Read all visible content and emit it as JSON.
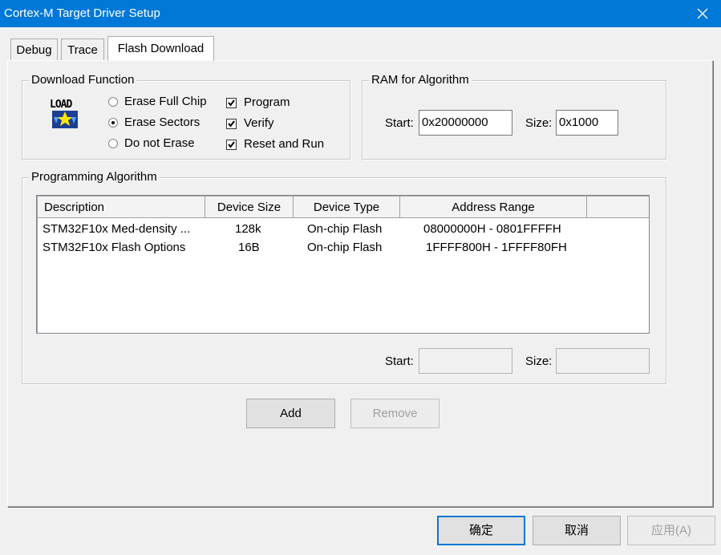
{
  "window": {
    "title": "Cortex-M Target Driver Setup"
  },
  "tabs": [
    {
      "label": "Debug",
      "active": false
    },
    {
      "label": "Trace",
      "active": false
    },
    {
      "label": "Flash Download",
      "active": true
    }
  ],
  "download_function": {
    "group_label": "Download Function",
    "icon_text": "LOAD",
    "radios": [
      {
        "label": "Erase Full Chip",
        "selected": false
      },
      {
        "label": "Erase Sectors",
        "selected": true
      },
      {
        "label": "Do not Erase",
        "selected": false
      }
    ],
    "checks": [
      {
        "label": "Program",
        "checked": true
      },
      {
        "label": "Verify",
        "checked": true
      },
      {
        "label": "Reset and Run",
        "checked": true
      }
    ]
  },
  "ram": {
    "group_label": "RAM for Algorithm",
    "start_label": "Start:",
    "start_value": "0x20000000",
    "size_label": "Size:",
    "size_value": "0x1000"
  },
  "algorithm": {
    "group_label": "Programming Algorithm",
    "columns": [
      "Description",
      "Device Size",
      "Device Type",
      "Address Range"
    ],
    "rows": [
      {
        "description": "STM32F10x Med-density ...",
        "size": "128k",
        "type": "On-chip Flash",
        "range": "08000000H - 0801FFFFH"
      },
      {
        "description": "STM32F10x Flash Options",
        "size": "16B",
        "type": "On-chip Flash",
        "range": "1FFFF800H - 1FFFF80FH"
      }
    ],
    "start_label": "Start:",
    "start_value": "",
    "size_label": "Size:",
    "size_value": ""
  },
  "buttons": {
    "add": "Add",
    "remove": "Remove",
    "ok": "确定",
    "cancel": "取消",
    "apply": "应用(A)"
  },
  "colors": {
    "titlebar": "#0078d7",
    "default_button_border": "#0078d7"
  }
}
